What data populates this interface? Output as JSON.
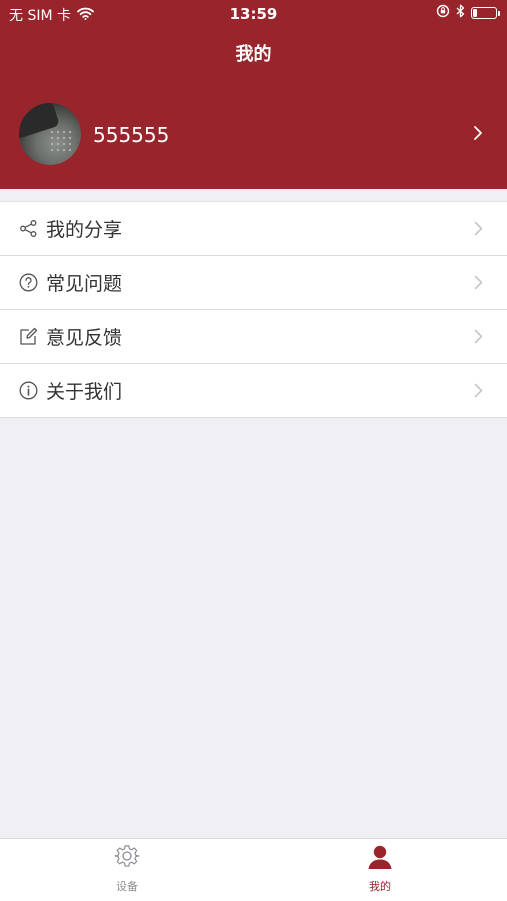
{
  "status_bar": {
    "carrier": "无 SIM 卡",
    "time": "13:59",
    "battery_level": 0.2
  },
  "header": {
    "title": "我的"
  },
  "profile": {
    "username": "555555"
  },
  "menu": {
    "items": [
      {
        "label": "我的分享",
        "icon": "share-icon"
      },
      {
        "label": "常见问题",
        "icon": "question-circle-icon"
      },
      {
        "label": "意见反馈",
        "icon": "edit-icon"
      },
      {
        "label": "关于我们",
        "icon": "info-circle-icon"
      }
    ]
  },
  "tabbar": {
    "tabs": [
      {
        "label": "设备",
        "icon": "gear-icon",
        "active": false
      },
      {
        "label": "我的",
        "icon": "user-icon",
        "active": true
      }
    ]
  },
  "colors": {
    "brand": "#97252B",
    "background": "#EFEFF4",
    "tab_inactive": "#8E8E93",
    "tab_active": "#97252B"
  }
}
